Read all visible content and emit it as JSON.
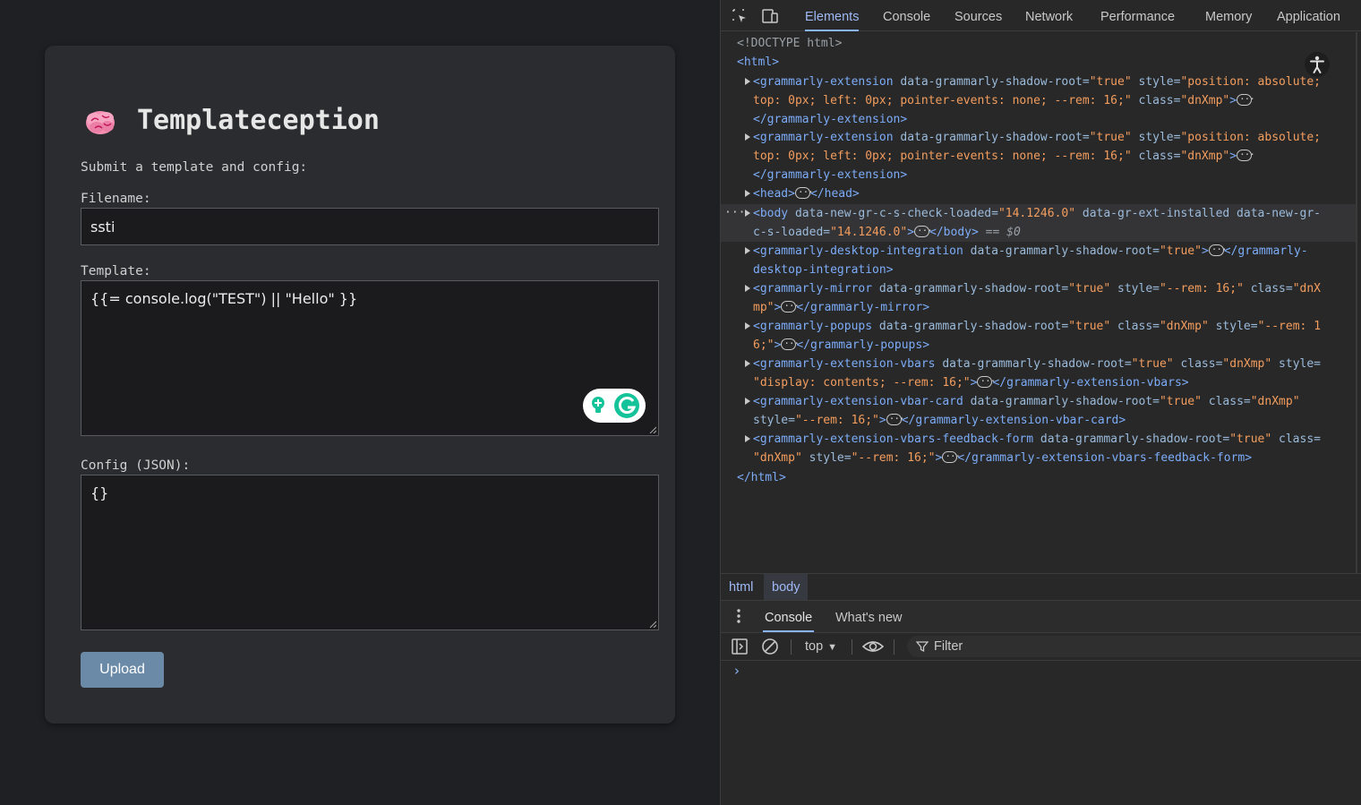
{
  "page": {
    "title": "Templateception",
    "subtitle": "Submit a template and config:",
    "filename_label": "Filename:",
    "filename_value": "ssti",
    "template_label": "Template:",
    "template_value": "{{= console.log(\"TEST\") || \"Hello\" }}",
    "config_label": "Config (JSON):",
    "config_value": "{}",
    "upload_label": "Upload",
    "colors": {
      "background": "#1f2023",
      "card": "#2b2c2f",
      "button": "#6a8aa8",
      "grammarly": "#15c39a"
    },
    "icons": [
      "brain-icon",
      "grammarly-icon"
    ]
  },
  "devtools": {
    "tabs": [
      "Elements",
      "Console",
      "Sources",
      "Network",
      "Performance",
      "Memory",
      "Application"
    ],
    "active_tab": "Elements",
    "tree": {
      "doctype": "<!DOCTYPE html>",
      "html_open": "<html>",
      "html_close": "</html>",
      "ge1_a": "<grammarly-extension",
      "ge1_b": " data-grammarly-shadow-root=",
      "ge1_c": "\"true\"",
      "ge1_d": " style=",
      "ge1_e": "\"position: absolute;",
      "ge1_f": "top: 0px; left: 0px; pointer-events: none; --rem: 16;\"",
      "ge1_g": " class=",
      "ge1_h": "\"dnXmp\"",
      "ge1_i": ">",
      "ge1_close": "</grammarly-extension>",
      "head_open": "<head>",
      "head_close": "</head>",
      "body_a": "<body",
      "body_b": " data-new-gr-c-s-check-loaded=",
      "body_c": "\"14.1246.0\"",
      "body_d": " data-gr-ext-installed",
      "body_e": " data-new-gr-",
      "body_f": "c-s-loaded=",
      "body_g": "\"14.1246.0\"",
      "body_h": ">",
      "body_close": "</body>",
      "body_eq": " == $0",
      "gdi_a": "<grammarly-desktop-integration",
      "gdi_b": " data-grammarly-shadow-root=",
      "gdi_c": "\"true\"",
      "gdi_d": ">",
      "gdi_e": "</grammarly-",
      "gdi_f": "desktop-integration>",
      "gm_a": "<grammarly-mirror",
      "gm_b": " data-grammarly-shadow-root=",
      "gm_c": "\"true\"",
      "gm_d": " style=",
      "gm_e": "\"--rem: 16;\"",
      "gm_f": " class=",
      "gm_g": "\"dnX",
      "gm_h": "mp\"",
      "gm_i": ">",
      "gm_close": "</grammarly-mirror>",
      "gp_a": "<grammarly-popups",
      "gp_b": " data-grammarly-shadow-root=",
      "gp_c": "\"true\"",
      "gp_d": " class=",
      "gp_e": "\"dnXmp\"",
      "gp_f": " style=",
      "gp_g": "\"--rem: 1",
      "gp_h": "6;\"",
      "gp_i": ">",
      "gp_close": "</grammarly-popups>",
      "gv_a": "<grammarly-extension-vbars",
      "gv_b": " data-grammarly-shadow-root=",
      "gv_c": "\"true\"",
      "gv_d": " class=",
      "gv_e": "\"dnXmp\"",
      "gv_f": " style=",
      "gv_g": "\"display: contents; --rem: 16;\"",
      "gv_h": ">",
      "gv_close": "</grammarly-extension-vbars>",
      "gvc_a": "<grammarly-extension-vbar-card",
      "gvc_b": " data-grammarly-shadow-root=",
      "gvc_c": "\"true\"",
      "gvc_d": " class=",
      "gvc_e": "\"dnXmp\"",
      "gvc_f": "style=",
      "gvc_g": "\"--rem: 16;\"",
      "gvc_h": ">",
      "gvc_close": "</grammarly-extension-vbar-card>",
      "gvf_a": "<grammarly-extension-vbars-feedback-form",
      "gvf_b": " data-grammarly-shadow-root=",
      "gvf_c": "\"true\"",
      "gvf_d": " class=",
      "gvf_e": "\"dnXmp\"",
      "gvf_f": " style=",
      "gvf_g": "\"--rem: 16;\"",
      "gvf_h": ">",
      "gvf_close": "</grammarly-extension-vbars-feedback-form>",
      "ellipsis": "···"
    },
    "breadcrumbs": [
      "html",
      "body"
    ],
    "drawer_tabs": [
      "Console",
      "What's new"
    ],
    "console": {
      "context": "top",
      "filter_placeholder": "Filter",
      "prompt": "›"
    },
    "colors": {
      "panel": "#282828",
      "tag": "#7cacf8",
      "attr_name": "#9bbbdc",
      "attr_value": "#f39d5e",
      "active_tab": "#8ab4f8"
    },
    "icons": [
      "inspect-icon",
      "device-toggle-icon",
      "accessibility-icon",
      "expand-triangle-icon",
      "ellipsis-icon",
      "sidebar-toggle-icon",
      "clear-console-icon",
      "eye-icon",
      "filter-icon",
      "kebab-menu-icon"
    ]
  }
}
